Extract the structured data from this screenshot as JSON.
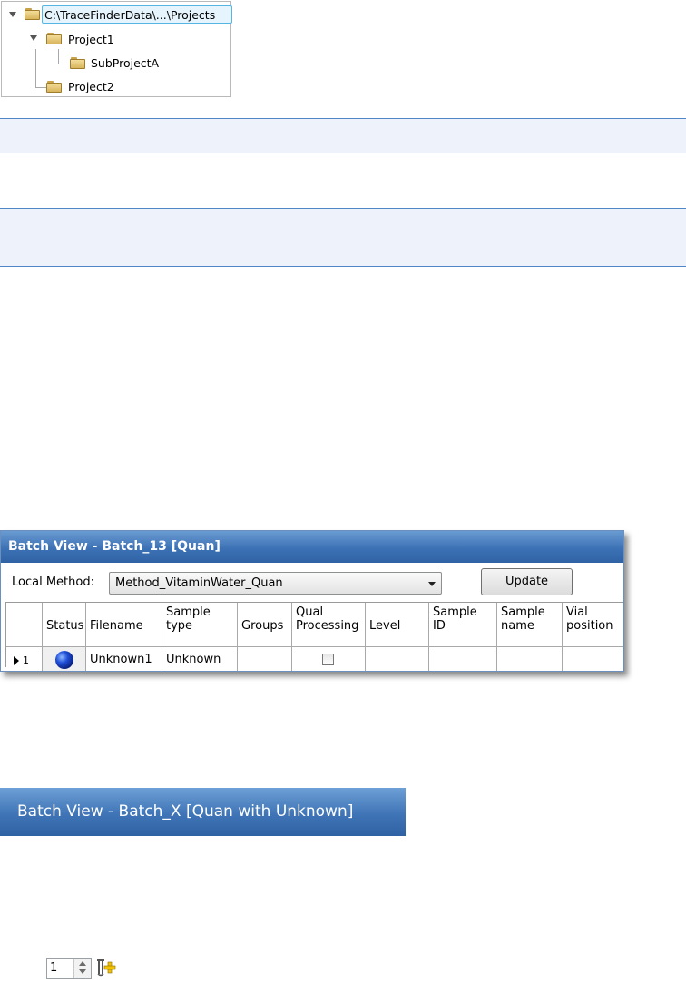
{
  "tree": {
    "root": "C:\\TraceFinderData\\...\\Projects",
    "project1": "Project1",
    "subproject": "SubProjectA",
    "project2": "Project2"
  },
  "batch_view": {
    "title": "Batch View - Batch_13 [Quan]",
    "local_method_label": "Local Method:",
    "local_method_value": "Method_VitaminWater_Quan",
    "update_label": "Update",
    "columns": [
      "Status",
      "Filename",
      "Sample type",
      "Groups",
      "Qual Processing",
      "Level",
      "Sample ID",
      "Sample name",
      "Vial position"
    ],
    "row": {
      "index": "1",
      "filename": "Unknown1",
      "sample_type": "Unknown"
    }
  },
  "header_strip": {
    "title": "Batch View - Batch_X [Quan with Unknown]"
  },
  "spinner": {
    "value": "1"
  }
}
